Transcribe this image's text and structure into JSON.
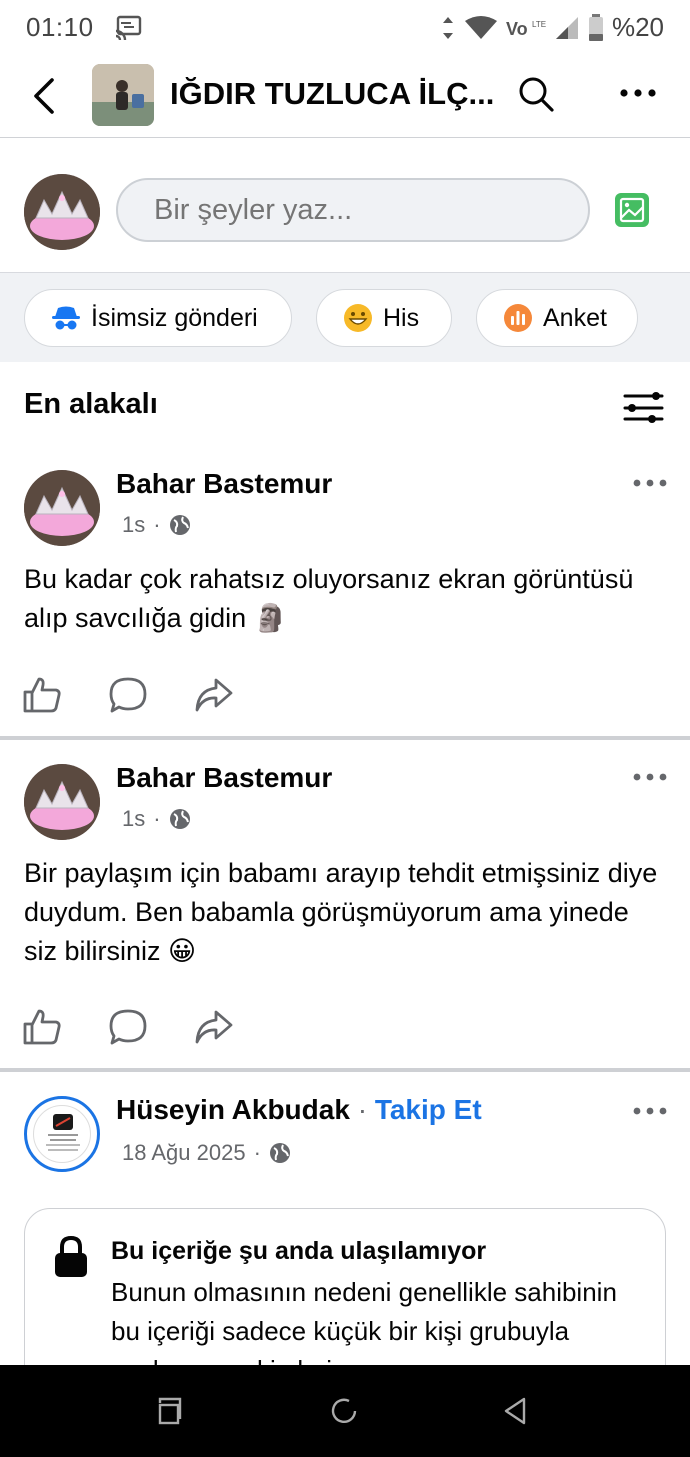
{
  "status_bar": {
    "time": "01:10",
    "battery": "%20"
  },
  "header": {
    "title": "IĞDIR TUZLUCA İLÇ..."
  },
  "composer": {
    "placeholder": "Bir şeyler yaz..."
  },
  "pills": [
    {
      "label": "İsimsiz gönderi",
      "icon": "incognito-icon"
    },
    {
      "label": "His",
      "icon": "smiley-icon"
    },
    {
      "label": "Anket",
      "icon": "poll-icon"
    }
  ],
  "sort": {
    "label": "En alakalı"
  },
  "posts": [
    {
      "author": "Bahar Bastemur",
      "time": "1s",
      "text": "Bu kadar çok rahatsız oluyorsanız ekran görüntüsü alıp savcılığa gidin 🗿"
    },
    {
      "author": "Bahar Bastemur",
      "time": "1s",
      "text": "Bir paylaşım için babamı arayıp tehdit etmişsiniz diye duydum. Ben babamla görüşmüyorum ama yinede siz bilirsiniz 😀"
    },
    {
      "author": "Hüseyin Akbudak",
      "follow": "Takip Et",
      "time": "18 Ağu 2025"
    }
  ],
  "unavailable": {
    "title": "Bu içeriğe şu anda ulaşılamıyor",
    "body": "Bunun olmasının nedeni genellikle sahibinin bu içeriği sadece küçük bir kişi grubuyla paylaşması, kimlerin"
  },
  "colors": {
    "accent": "#1b74e4",
    "secondary_text": "#65676b",
    "input_bg": "#f0f2f5"
  }
}
